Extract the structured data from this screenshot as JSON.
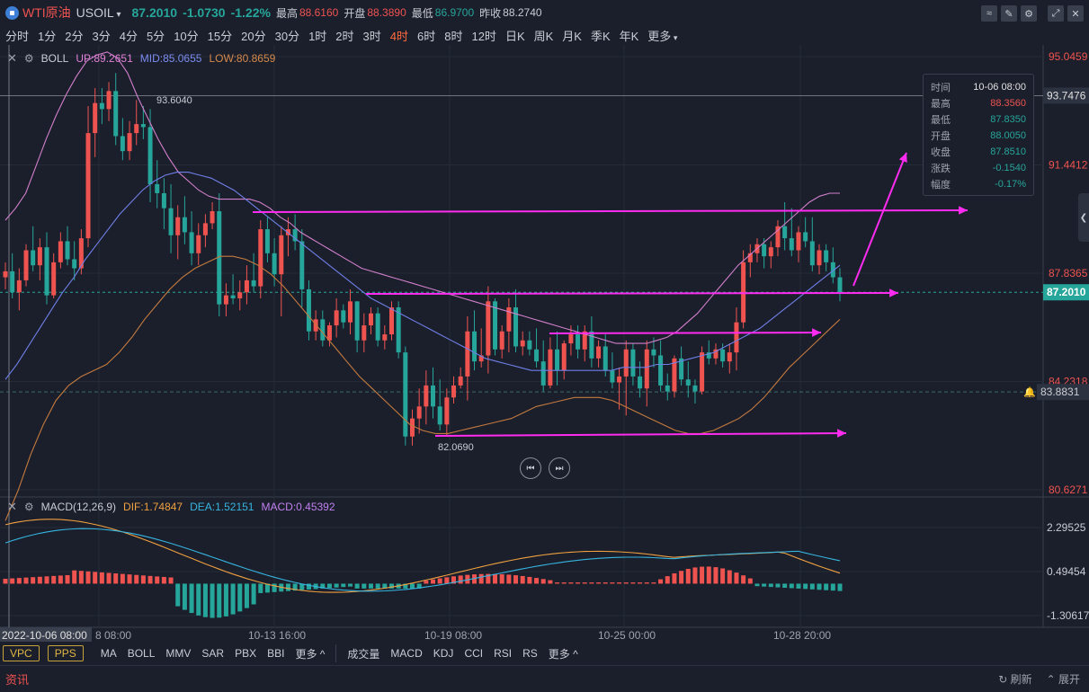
{
  "header": {
    "name": "WTI原油",
    "code": "USOIL",
    "price": "87.2010",
    "change": "-1.0730",
    "change_pct": "-1.22%",
    "high_label": "最高",
    "high": "88.6160",
    "open_label": "开盘",
    "open": "88.3890",
    "low_label": "最低",
    "low": "86.9700",
    "prev_label": "昨收",
    "prev": "88.2740"
  },
  "periods": [
    "分时",
    "1分",
    "2分",
    "3分",
    "4分",
    "5分",
    "10分",
    "15分",
    "20分",
    "30分",
    "1时",
    "2时",
    "3时",
    "4时",
    "6时",
    "8时",
    "12时",
    "日K",
    "周K",
    "月K",
    "季K",
    "年K",
    "更多"
  ],
  "active_period": "4时",
  "boll": {
    "name": "BOLL",
    "up": "UP:89.2651",
    "mid": "MID:85.0655",
    "low": "LOW:80.8659"
  },
  "macd": {
    "name": "MACD(12,26,9)",
    "dif": "DIF:1.74847",
    "dea": "DEA:1.52151",
    "macd": "MACD:0.45392"
  },
  "tooltip": {
    "rows": [
      {
        "k": "时间",
        "v": "10-06 08:00",
        "color": "#e0e0e0"
      },
      {
        "k": "最高",
        "v": "88.3560",
        "color": "#ef5350"
      },
      {
        "k": "最低",
        "v": "87.8350",
        "color": "#26a69a"
      },
      {
        "k": "开盘",
        "v": "88.0050",
        "color": "#26a69a"
      },
      {
        "k": "收盘",
        "v": "87.8510",
        "color": "#26a69a"
      },
      {
        "k": "涨跌",
        "v": "-0.1540",
        "color": "#26a69a"
      },
      {
        "k": "幅度",
        "v": "-0.17%",
        "color": "#26a69a"
      }
    ]
  },
  "bottom": {
    "chips": [
      "VPC",
      "PPS"
    ],
    "main_tabs": [
      "MA",
      "BOLL",
      "MMV",
      "SAR",
      "PBX",
      "BBI",
      "更多 ^"
    ],
    "sub_tabs": [
      "成交量",
      "MACD",
      "KDJ",
      "CCI",
      "RSI",
      "RS",
      "更多 ^"
    ]
  },
  "footer": {
    "news": "资讯",
    "refresh": "刷新",
    "expand": "展开"
  },
  "chart_data": {
    "type": "candlestick",
    "price_axis_ticks": [
      "95.0459",
      "91.4412",
      "87.8365",
      "84.2318",
      "80.6271"
    ],
    "price_axis_values": [
      95.0459,
      91.4412,
      87.8365,
      84.2318,
      80.6271
    ],
    "macd_axis_ticks": [
      "2.29525",
      "0.49454",
      "-1.30617"
    ],
    "macd_axis_values": [
      2.29525,
      0.49454,
      -1.30617
    ],
    "x_labels": [
      "2022-10-06 08:00",
      "8 08:00",
      "10-13 16:00",
      "10-19 08:00",
      "10-25 00:00",
      "10-28 20:00"
    ],
    "current_price": "87.2010",
    "current_value": 87.201,
    "crosshair_price": "93.7476",
    "crosshair_value": 93.7476,
    "alert_price": "83.8831",
    "alert_value": 83.8831,
    "annotations": [
      "93.6040",
      "82.0690"
    ],
    "annotation_values": [
      93.604,
      82.069
    ],
    "ohlc": [
      [
        87.7,
        88.2,
        87.3,
        87.9
      ],
      [
        87.9,
        88.5,
        87.0,
        87.2
      ],
      [
        87.2,
        88.0,
        86.6,
        87.6
      ],
      [
        87.6,
        88.8,
        87.4,
        88.6
      ],
      [
        88.6,
        89.4,
        87.9,
        88.1
      ],
      [
        88.1,
        89.0,
        87.6,
        88.7
      ],
      [
        88.7,
        89.2,
        86.8,
        87.1
      ],
      [
        87.1,
        88.5,
        87.0,
        88.2
      ],
      [
        88.2,
        89.2,
        88.0,
        88.9
      ],
      [
        88.9,
        89.4,
        88.1,
        88.3
      ],
      [
        88.3,
        88.9,
        87.6,
        88.0
      ],
      [
        88.0,
        89.3,
        87.8,
        89.0
      ],
      [
        89.0,
        93.4,
        88.7,
        92.5
      ],
      [
        92.5,
        94.0,
        91.7,
        93.5
      ],
      [
        93.5,
        94.0,
        92.8,
        93.3
      ],
      [
        93.3,
        94.2,
        92.9,
        93.9
      ],
      [
        93.9,
        94.5,
        92.1,
        92.4
      ],
      [
        92.4,
        93.0,
        91.6,
        91.9
      ],
      [
        91.9,
        92.9,
        91.6,
        92.5
      ],
      [
        92.5,
        93.6,
        92.1,
        92.8
      ],
      [
        92.8,
        93.4,
        92.3,
        92.7
      ],
      [
        92.7,
        93.3,
        90.2,
        90.8
      ],
      [
        90.8,
        91.6,
        90.0,
        90.5
      ],
      [
        90.5,
        91.0,
        89.3,
        90.0
      ],
      [
        90.0,
        90.8,
        88.5,
        89.1
      ],
      [
        89.1,
        90.1,
        88.3,
        89.7
      ],
      [
        89.7,
        90.4,
        88.8,
        89.2
      ],
      [
        89.2,
        89.9,
        88.1,
        88.5
      ],
      [
        88.5,
        89.5,
        88.1,
        89.1
      ],
      [
        89.1,
        89.8,
        88.7,
        89.5
      ],
      [
        89.5,
        90.2,
        89.3,
        89.9
      ],
      [
        89.9,
        90.5,
        86.4,
        86.8
      ],
      [
        86.8,
        87.5,
        86.4,
        87.1
      ],
      [
        87.1,
        87.8,
        86.8,
        87.0
      ],
      [
        87.0,
        87.6,
        86.6,
        87.2
      ],
      [
        87.2,
        88.1,
        86.8,
        87.6
      ],
      [
        87.6,
        88.5,
        87.2,
        87.4
      ],
      [
        87.4,
        89.6,
        87.0,
        89.3
      ],
      [
        89.3,
        89.7,
        88.2,
        88.5
      ],
      [
        88.5,
        89.0,
        87.4,
        87.8
      ],
      [
        87.8,
        89.4,
        86.4,
        89.1
      ],
      [
        89.1,
        89.7,
        88.4,
        89.3
      ],
      [
        89.3,
        89.8,
        88.6,
        88.9
      ],
      [
        88.9,
        89.3,
        86.7,
        87.3
      ],
      [
        87.3,
        87.6,
        85.6,
        85.9
      ],
      [
        85.9,
        86.6,
        85.6,
        86.3
      ],
      [
        86.3,
        86.6,
        85.4,
        85.6
      ],
      [
        85.6,
        86.2,
        85.4,
        86.1
      ],
      [
        86.1,
        87.0,
        85.7,
        86.6
      ],
      [
        86.6,
        86.8,
        86.0,
        86.2
      ],
      [
        86.2,
        87.3,
        85.8,
        86.9
      ],
      [
        86.9,
        86.9,
        85.2,
        85.6
      ],
      [
        85.6,
        86.5,
        85.2,
        86.1
      ],
      [
        86.1,
        86.7,
        85.8,
        86.5
      ],
      [
        86.5,
        86.7,
        85.4,
        85.6
      ],
      [
        85.6,
        86.1,
        85.3,
        85.8
      ],
      [
        85.8,
        86.9,
        85.6,
        86.7
      ],
      [
        86.7,
        86.9,
        85.0,
        85.2
      ],
      [
        85.2,
        85.4,
        82.1,
        82.4
      ],
      [
        82.4,
        83.3,
        82.1,
        83.0
      ],
      [
        83.0,
        84.0,
        82.5,
        83.4
      ],
      [
        83.4,
        84.6,
        82.8,
        84.1
      ],
      [
        84.1,
        84.7,
        83.0,
        83.4
      ],
      [
        83.4,
        84.3,
        82.6,
        82.8
      ],
      [
        82.8,
        84.0,
        82.4,
        83.7
      ],
      [
        83.7,
        84.4,
        83.5,
        84.1
      ],
      [
        84.1,
        84.7,
        84.0,
        84.4
      ],
      [
        84.4,
        86.4,
        83.6,
        85.9
      ],
      [
        85.9,
        86.6,
        84.6,
        84.9
      ],
      [
        84.9,
        86.0,
        84.7,
        85.1
      ],
      [
        85.1,
        87.4,
        84.5,
        86.9
      ],
      [
        86.9,
        87.0,
        85.1,
        85.3
      ],
      [
        85.3,
        86.1,
        85.0,
        85.9
      ],
      [
        85.9,
        87.0,
        85.2,
        86.7
      ],
      [
        86.7,
        87.3,
        85.2,
        85.4
      ],
      [
        85.4,
        85.9,
        85.1,
        85.6
      ],
      [
        85.6,
        85.9,
        85.1,
        85.3
      ],
      [
        85.3,
        86.0,
        84.7,
        84.9
      ],
      [
        84.9,
        85.6,
        83.9,
        84.1
      ],
      [
        84.1,
        85.7,
        84.0,
        85.3
      ],
      [
        85.3,
        85.9,
        84.1,
        84.6
      ],
      [
        84.6,
        85.6,
        84.3,
        85.5
      ],
      [
        85.5,
        86.1,
        85.1,
        85.8
      ],
      [
        85.8,
        86.1,
        85.0,
        85.3
      ],
      [
        85.3,
        86.1,
        84.9,
        85.9
      ],
      [
        85.9,
        86.4,
        84.7,
        85.0
      ],
      [
        85.0,
        85.6,
        84.7,
        85.4
      ],
      [
        85.4,
        85.8,
        84.4,
        84.6
      ],
      [
        84.6,
        85.2,
        84.0,
        84.2
      ],
      [
        84.2,
        84.7,
        83.3,
        84.4
      ],
      [
        84.4,
        85.6,
        83.1,
        85.3
      ],
      [
        85.3,
        85.5,
        84.1,
        84.4
      ],
      [
        84.4,
        84.9,
        83.7,
        84.0
      ],
      [
        84.0,
        85.6,
        83.4,
        85.3
      ],
      [
        85.3,
        85.7,
        84.7,
        85.1
      ],
      [
        85.1,
        85.6,
        83.9,
        84.1
      ],
      [
        84.1,
        84.5,
        83.6,
        83.9
      ],
      [
        83.9,
        85.1,
        83.7,
        85.0
      ],
      [
        85.0,
        85.4,
        84.1,
        84.3
      ],
      [
        84.3,
        84.9,
        83.7,
        84.1
      ],
      [
        84.1,
        84.3,
        83.5,
        83.9
      ],
      [
        83.9,
        85.4,
        83.8,
        85.2
      ],
      [
        85.2,
        85.6,
        84.8,
        85.0
      ],
      [
        85.0,
        85.5,
        84.8,
        85.3
      ],
      [
        85.3,
        85.5,
        84.7,
        84.9
      ],
      [
        84.9,
        85.5,
        84.5,
        85.2
      ],
      [
        85.2,
        86.7,
        84.6,
        86.2
      ],
      [
        86.2,
        88.6,
        86.0,
        88.2
      ],
      [
        88.2,
        88.8,
        87.7,
        88.5
      ],
      [
        88.5,
        89.0,
        88.2,
        88.8
      ],
      [
        88.8,
        89.0,
        88.0,
        88.4
      ],
      [
        88.4,
        88.9,
        88.0,
        88.7
      ],
      [
        88.7,
        89.6,
        88.4,
        89.4
      ],
      [
        89.4,
        90.2,
        88.6,
        89.0
      ],
      [
        89.0,
        90.0,
        88.4,
        88.6
      ],
      [
        88.6,
        89.4,
        88.2,
        89.2
      ],
      [
        89.2,
        89.7,
        88.7,
        88.9
      ],
      [
        88.9,
        89.7,
        87.9,
        88.1
      ],
      [
        88.1,
        88.8,
        87.8,
        88.6
      ],
      [
        88.6,
        88.8,
        87.9,
        88.2
      ],
      [
        88.2,
        88.7,
        87.5,
        87.7
      ],
      [
        87.7,
        88.0,
        86.9,
        87.2
      ]
    ],
    "boll_up": [
      89.6,
      90.0,
      90.5,
      91.4,
      92.3,
      93.1,
      93.8,
      94.4,
      94.9,
      95.1,
      95.2,
      95.0,
      94.5,
      93.7,
      93.0,
      92.3,
      91.7,
      91.2,
      90.9,
      90.6,
      90.4,
      90.3,
      90.3,
      90.3,
      90.3,
      90.2,
      90.0,
      89.7,
      89.5,
      89.2,
      89.0,
      88.8,
      88.6,
      88.4,
      88.2,
      88.0,
      87.9,
      87.8,
      87.7,
      87.6,
      87.5,
      87.4,
      87.3,
      87.2,
      87.1,
      87.0,
      86.9,
      86.8,
      86.7,
      86.6,
      86.5,
      86.4,
      86.3,
      86.2,
      86.1,
      86.0,
      85.9,
      85.8,
      85.7,
      85.6,
      85.5,
      85.5,
      85.5,
      85.5,
      85.6,
      85.7,
      85.9,
      86.2,
      86.5,
      86.9,
      87.3,
      87.7,
      88.1,
      88.4,
      88.7,
      89.0,
      89.3,
      89.6,
      89.9,
      90.2,
      90.4,
      90.5,
      90.5
    ],
    "boll_mid": [
      84.3,
      84.8,
      85.4,
      86.0,
      86.6,
      87.2,
      87.7,
      88.3,
      88.8,
      89.3,
      89.8,
      90.2,
      90.6,
      90.9,
      91.1,
      91.2,
      91.2,
      91.1,
      91.0,
      90.8,
      90.6,
      90.3,
      90.0,
      89.7,
      89.4,
      89.1,
      88.8,
      88.5,
      88.2,
      87.9,
      87.6,
      87.3,
      87.0,
      86.8,
      86.6,
      86.4,
      86.2,
      86.0,
      85.8,
      85.6,
      85.4,
      85.2,
      85.0,
      84.9,
      84.8,
      84.7,
      84.6,
      84.6,
      84.6,
      84.6,
      84.6,
      84.6,
      84.6,
      84.6,
      84.7,
      84.7,
      84.7,
      84.8,
      84.8,
      84.9,
      85.0,
      85.1,
      85.2,
      85.4,
      85.6,
      85.8,
      86.0,
      86.3,
      86.6,
      86.9,
      87.2,
      87.5,
      87.8,
      88.1
    ],
    "boll_low": [
      79.6,
      80.6,
      81.8,
      82.8,
      83.6,
      84.1,
      84.4,
      84.6,
      84.8,
      85.2,
      85.7,
      86.3,
      86.8,
      87.3,
      87.7,
      88.0,
      88.2,
      88.4,
      88.4,
      88.3,
      88.1,
      87.8,
      87.4,
      86.9,
      86.4,
      85.9,
      85.4,
      84.9,
      84.4,
      84.0,
      83.6,
      83.2,
      82.8,
      82.6,
      82.5,
      82.5,
      82.6,
      82.7,
      82.8,
      82.9,
      83.0,
      83.2,
      83.4,
      83.5,
      83.6,
      83.7,
      83.7,
      83.7,
      83.6,
      83.4,
      83.2,
      83.0,
      82.8,
      82.6,
      82.5,
      82.5,
      82.6,
      82.8,
      83.0,
      83.3,
      83.7,
      84.2,
      84.7,
      85.1,
      85.5,
      85.9,
      86.3
    ]
  }
}
